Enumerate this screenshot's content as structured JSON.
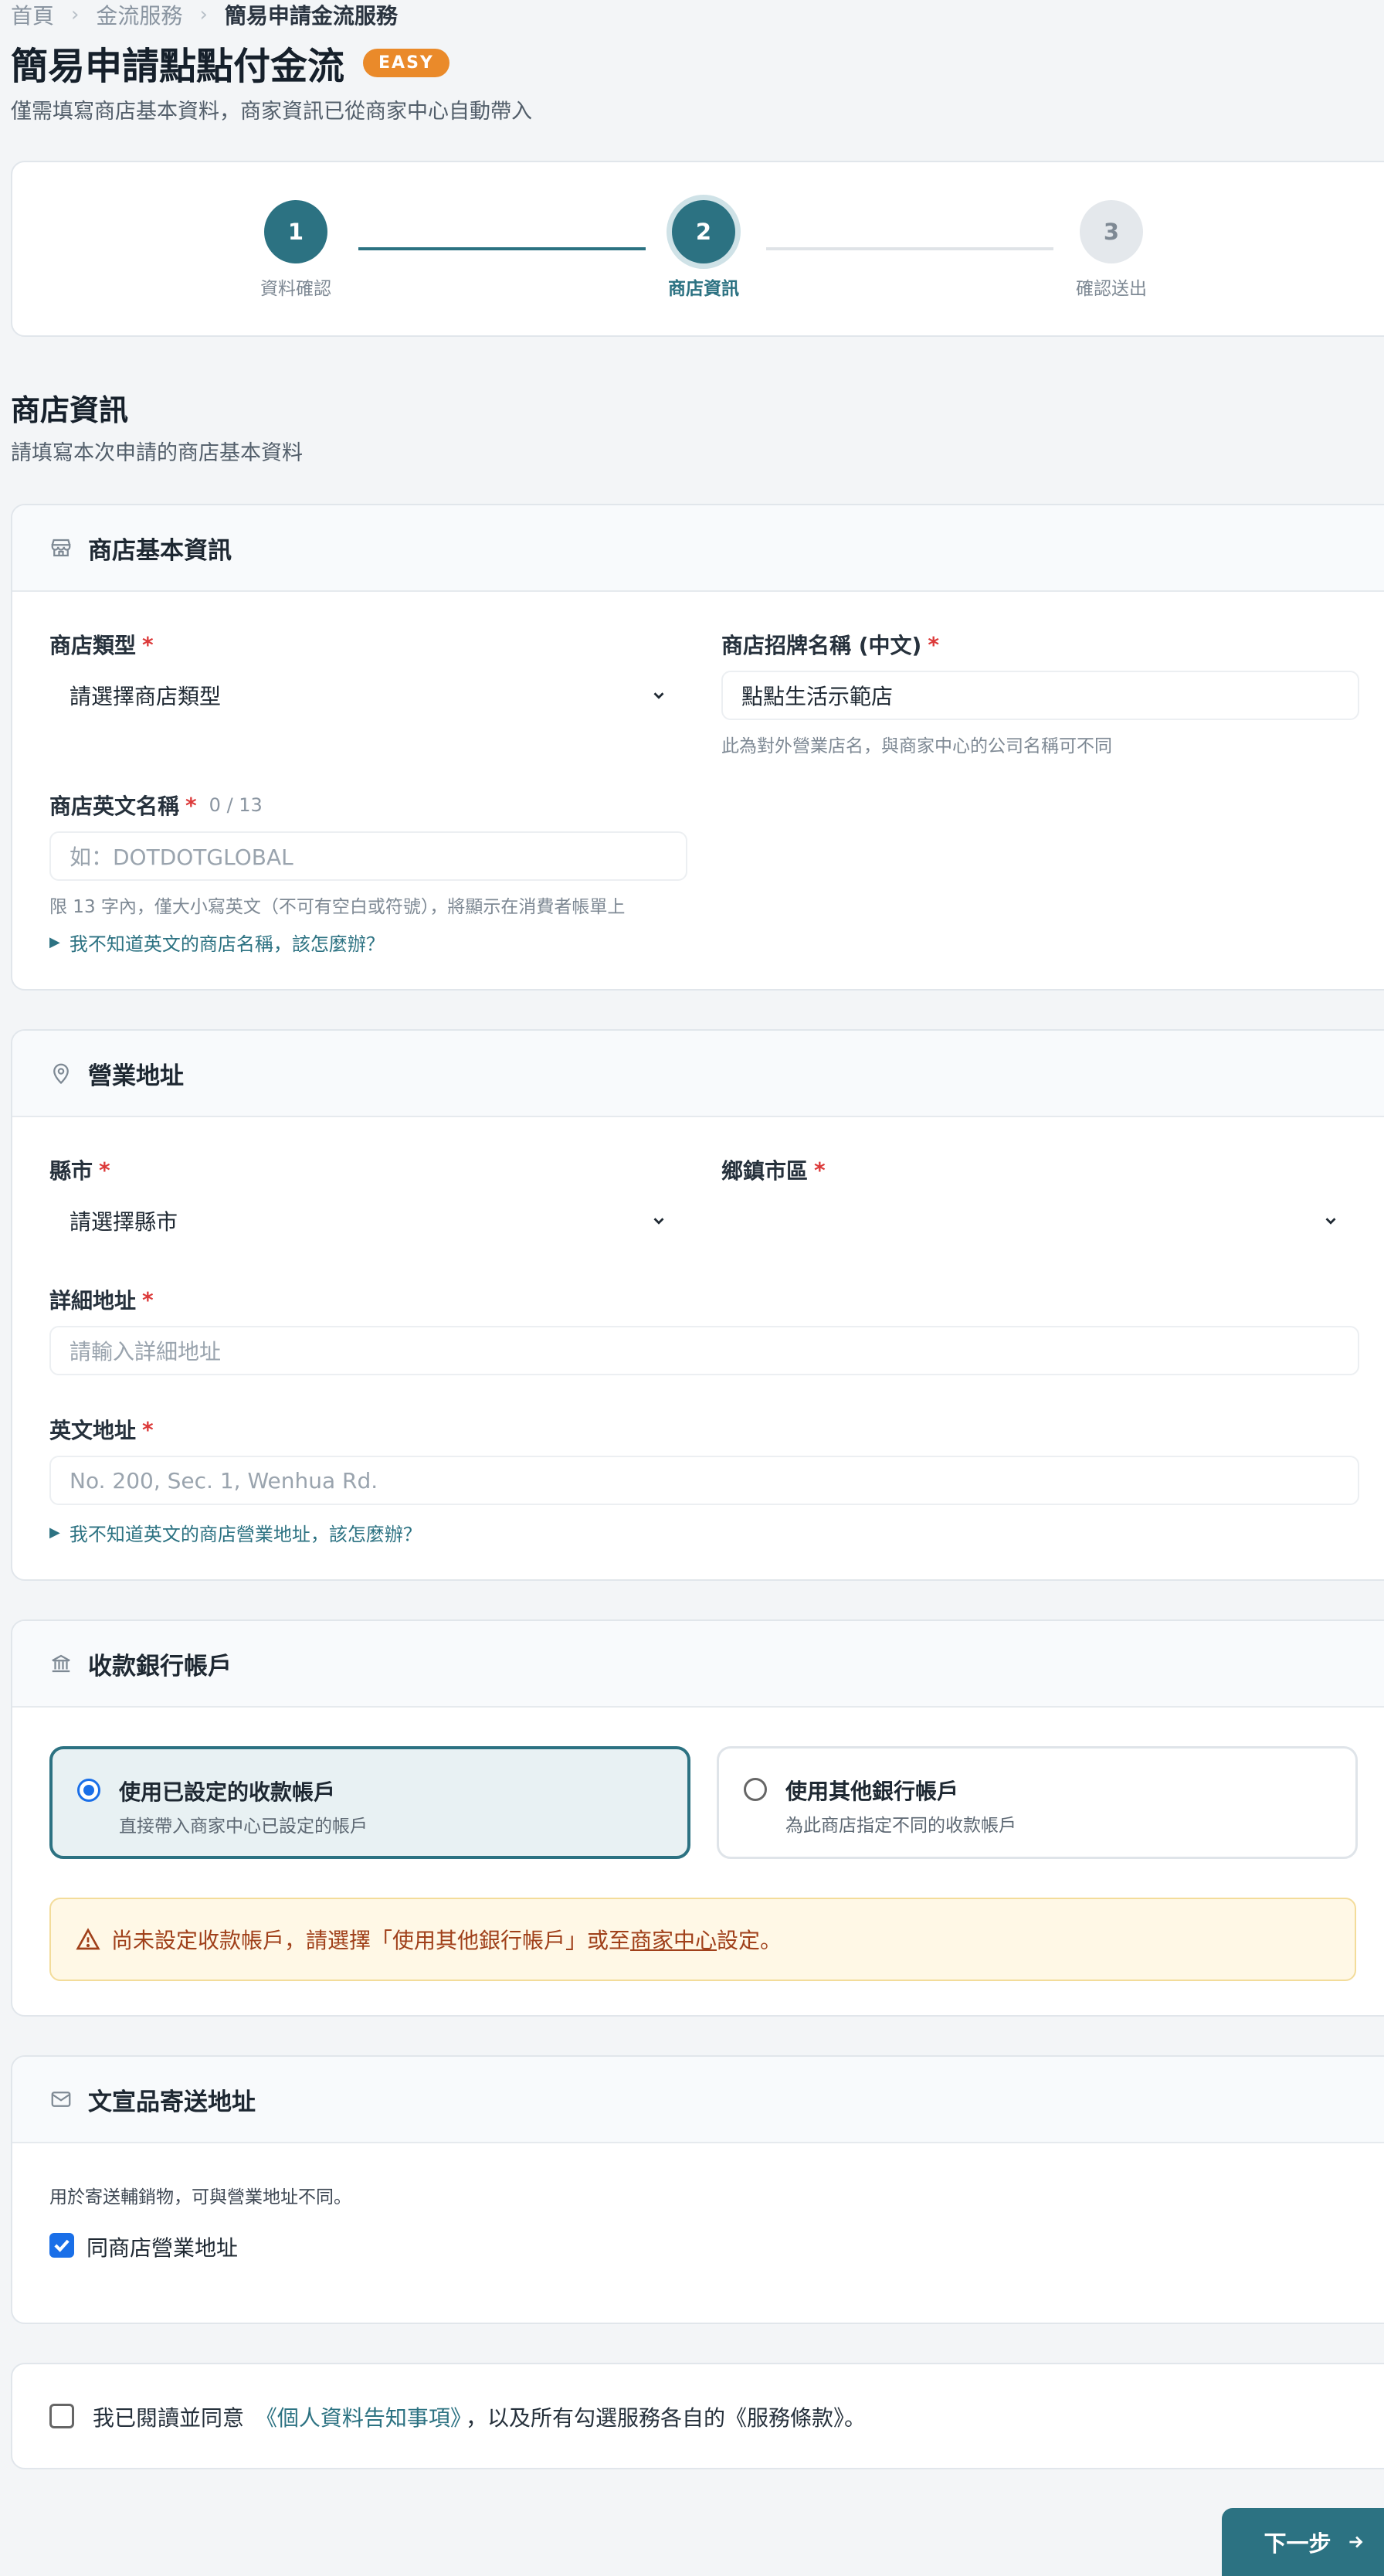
{
  "breadcrumb": [
    "首頁",
    "金流服務",
    "簡易申請金流服務"
  ],
  "page": {
    "title": "簡易申請點點付金流",
    "badge": "EASY",
    "subtitle": "僅需填寫商店基本資料，商家資訊已從商家中心自動帶入"
  },
  "stepper": {
    "steps": [
      {
        "num": "1",
        "label": "資料確認",
        "state": "done"
      },
      {
        "num": "2",
        "label": "商店資訊",
        "state": "active"
      },
      {
        "num": "3",
        "label": "確認送出",
        "state": "todo"
      }
    ],
    "colors": {
      "accent": "#2c7282",
      "inactive": "#e4e8ec"
    }
  },
  "section": {
    "title": "商店資訊",
    "subtitle": "請填寫本次申請的商店基本資料"
  },
  "store_basic": {
    "header": "商店基本資訊",
    "store_type": {
      "label": "商店類型",
      "placeholder": "請選擇商店類型"
    },
    "brand_name": {
      "label": "商店招牌名稱 (中文)",
      "value": "點點生活示範店",
      "hint": "此為對外營業店名，與商家中心的公司名稱可不同"
    },
    "english_name": {
      "label": "商店英文名稱",
      "counter": "0 / 13",
      "placeholder": "如：DOTDOTGLOBAL",
      "hint": "限 13 字內，僅大小寫英文（不可有空白或符號），將顯示在消費者帳單上",
      "help": "我不知道英文的商店名稱，該怎麼辦？"
    }
  },
  "address": {
    "header": "營業地址",
    "city": {
      "label": "縣市",
      "placeholder": "請選擇縣市"
    },
    "district": {
      "label": "鄉鎮市區",
      "placeholder": ""
    },
    "detail": {
      "label": "詳細地址",
      "placeholder": "請輸入詳細地址"
    },
    "english": {
      "label": "英文地址",
      "placeholder": "No. 200, Sec. 1, Wenhua Rd.",
      "help": "我不知道英文的商店營業地址，該怎麼辦？"
    }
  },
  "bank": {
    "header": "收款銀行帳戶",
    "option_existing": {
      "title": "使用已設定的收款帳戶",
      "desc": "直接帶入商家中心已設定的帳戶",
      "selected": true
    },
    "option_other": {
      "title": "使用其他銀行帳戶",
      "desc": "為此商店指定不同的收款帳戶",
      "selected": false
    },
    "warning_prefix": "尚未設定收款帳戶，請選擇「使用其他銀行帳戶」或至",
    "warning_link": "商家中心",
    "warning_suffix": "設定。"
  },
  "mailing": {
    "header": "文宣品寄送地址",
    "desc": "用於寄送輔銷物，可與營業地址不同。",
    "same_label": "同商店營業地址",
    "same_checked": true
  },
  "agreement": {
    "prefix": "我已閱讀並同意",
    "link": "《個人資料告知事項》",
    "suffix": "，以及所有勾選服務各自的《服務條款》。",
    "checked": false
  },
  "next_button": "下一步"
}
